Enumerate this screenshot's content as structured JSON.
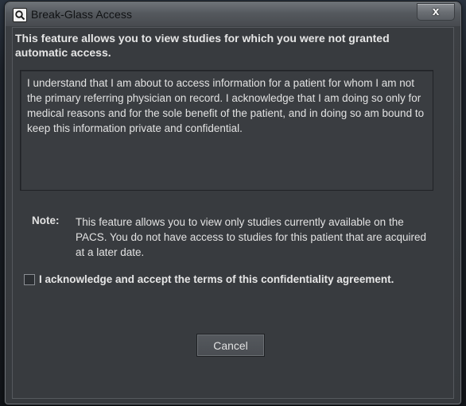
{
  "window": {
    "title": "Break-Glass Access",
    "app_icon": "magnifier-icon",
    "close_glyph": "x"
  },
  "dialog": {
    "intro": "This feature allows you to view studies for which you were not granted automatic access.",
    "agreement_text": "I understand that I am about to access information for a patient for whom I am not the primary referring physician on record. I acknowledge that I am doing so only for medical reasons and for the sole benefit of the patient, and in doing so am bound to keep this information private and confidential.",
    "note_label": "Note:",
    "note_text": "This feature allows you to view only studies currently available on the PACS. You do not have access to studies for this patient that are acquired at a later date.",
    "acknowledge": {
      "label": "I acknowledge and accept the terms of this confidentiality agreement.",
      "checked": false
    },
    "cancel_label": "Cancel"
  },
  "colors": {
    "background": "#383b3f",
    "text": "#e2e2e2",
    "titlebar": "#55595e"
  }
}
